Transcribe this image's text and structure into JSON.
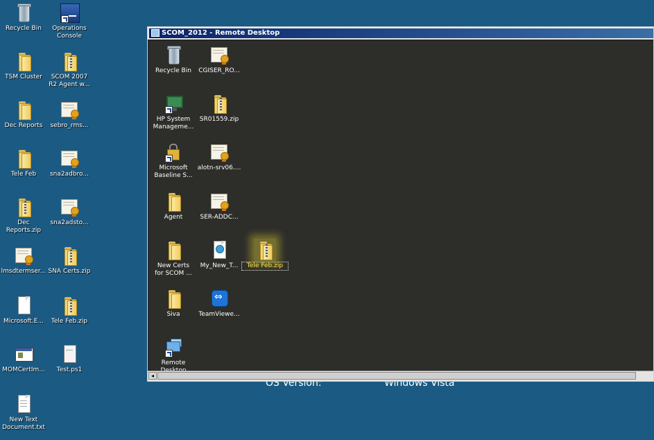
{
  "desktop": {
    "icons": [
      {
        "label": "Recycle Bin",
        "icon": "recycle-bin-icon"
      },
      {
        "label": "Operations\nConsole",
        "icon": "operations-console-icon"
      },
      {
        "label": "TSM Cluster",
        "icon": "folder-icon"
      },
      {
        "label": "SCOM 2007\nR2 Agent w...",
        "icon": "zip-folder-icon"
      },
      {
        "label": "Dec Reports",
        "icon": "folder-icon"
      },
      {
        "label": "sebro_rms...",
        "icon": "certificate-icon"
      },
      {
        "label": "Tele Feb",
        "icon": "folder-icon"
      },
      {
        "label": "sna2adbro...",
        "icon": "certificate-icon"
      },
      {
        "label": "Dec\nReports.zip",
        "icon": "zip-folder-icon"
      },
      {
        "label": "sna2adsto...",
        "icon": "certificate-icon"
      },
      {
        "label": "lmsdtermser...",
        "icon": "certificate-icon"
      },
      {
        "label": "SNA Certs.zip",
        "icon": "zip-folder-icon"
      },
      {
        "label": "Microsoft.E...",
        "icon": "document-icon"
      },
      {
        "label": "Tele Feb.zip",
        "icon": "zip-folder-icon"
      },
      {
        "label": "MOMCertIm...",
        "icon": "application-icon"
      },
      {
        "label": "Test.ps1",
        "icon": "script-file-icon"
      },
      {
        "label": "New Text\nDocument.txt",
        "icon": "text-document-icon"
      }
    ]
  },
  "remote_window": {
    "title": "SCOM_2012 - Remote Desktop",
    "icons": [
      {
        "label": "Recycle Bin",
        "icon": "recycle-bin-icon"
      },
      {
        "label": "CGISER_RO...",
        "icon": "certificate-icon"
      },
      {
        "label": "HP System\nManageme...",
        "icon": "hp-system-management-icon"
      },
      {
        "label": "SR01559.zip",
        "icon": "zip-folder-icon"
      },
      {
        "label": "Microsoft\nBaseline S...",
        "icon": "baseline-security-analyzer-icon"
      },
      {
        "label": "alotn-srv06....",
        "icon": "certificate-icon"
      },
      {
        "label": "Agent",
        "icon": "folder-icon"
      },
      {
        "label": "SER-ADDC...",
        "icon": "certificate-icon"
      },
      {
        "label": "New Certs\nfor SCOM ...",
        "icon": "folder-icon"
      },
      {
        "label": "My_New_T...",
        "icon": "html-document-icon"
      },
      {
        "label": "Tele Feb.zip",
        "icon": "zip-folder-icon"
      },
      {
        "label": "Siva",
        "icon": "folder-icon"
      },
      {
        "label": "TeamViewe...",
        "icon": "teamviewer-icon"
      },
      {
        "label": "Remote\nDesktop",
        "icon": "remote-desktop-icon"
      }
    ]
  },
  "background_text": {
    "os_version_label": "OS Version:",
    "os_version_value": "Windows Vista"
  }
}
